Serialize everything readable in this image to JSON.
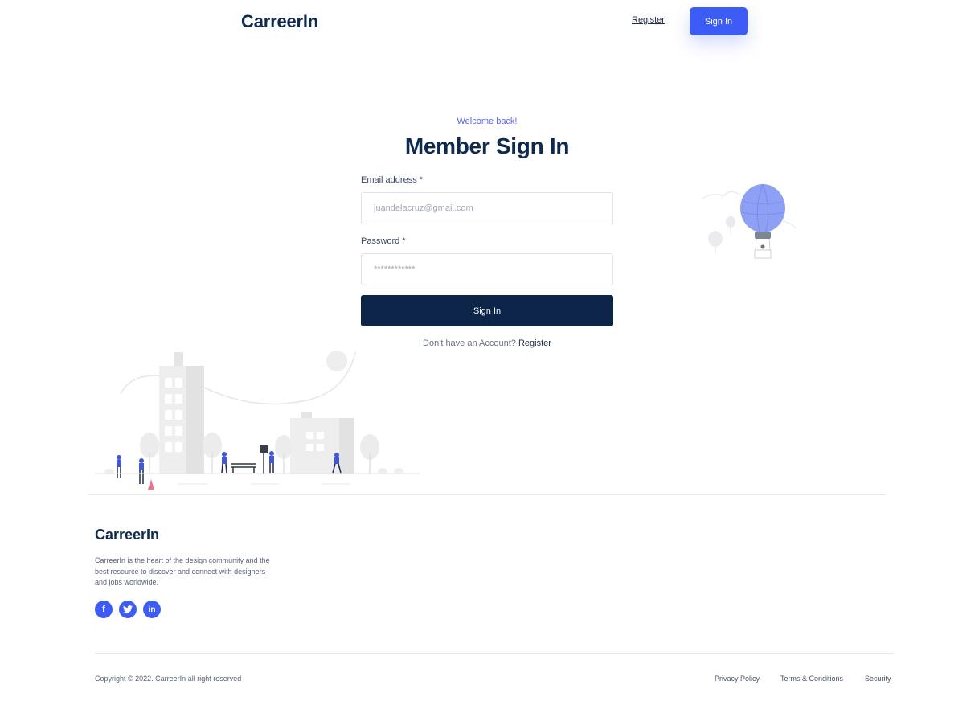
{
  "header": {
    "logo": "CarreerIn",
    "register_label": "Register",
    "signin_label": "Sign In"
  },
  "form": {
    "welcome": "Welcome back!",
    "title": "Member Sign In",
    "email_label": "Email address *",
    "email_placeholder": "juandelacruz@gmail.com",
    "password_label": "Password *",
    "password_placeholder": "************",
    "submit_label": "Sign In",
    "no_account_text": "Don't have an Account?",
    "register_link": "Register"
  },
  "footer": {
    "logo": "CarreerIn",
    "description": "CarreerIn is the heart of the design community and the best resource to discover and connect with designers and jobs worldwide.",
    "social": [
      {
        "icon": "facebook-icon",
        "glyph": "f"
      },
      {
        "icon": "twitter-icon",
        "glyph": "t"
      },
      {
        "icon": "linkedin-icon",
        "glyph": "in"
      }
    ],
    "copyright": "Copyright © 2022. CarreerIn all right reserved",
    "links": [
      "Privacy Policy",
      "Terms & Conditions",
      "Security"
    ]
  },
  "colors": {
    "primary": "#3d5cf5",
    "navy": "#0b2447",
    "accent_text": "#5b67e8"
  }
}
